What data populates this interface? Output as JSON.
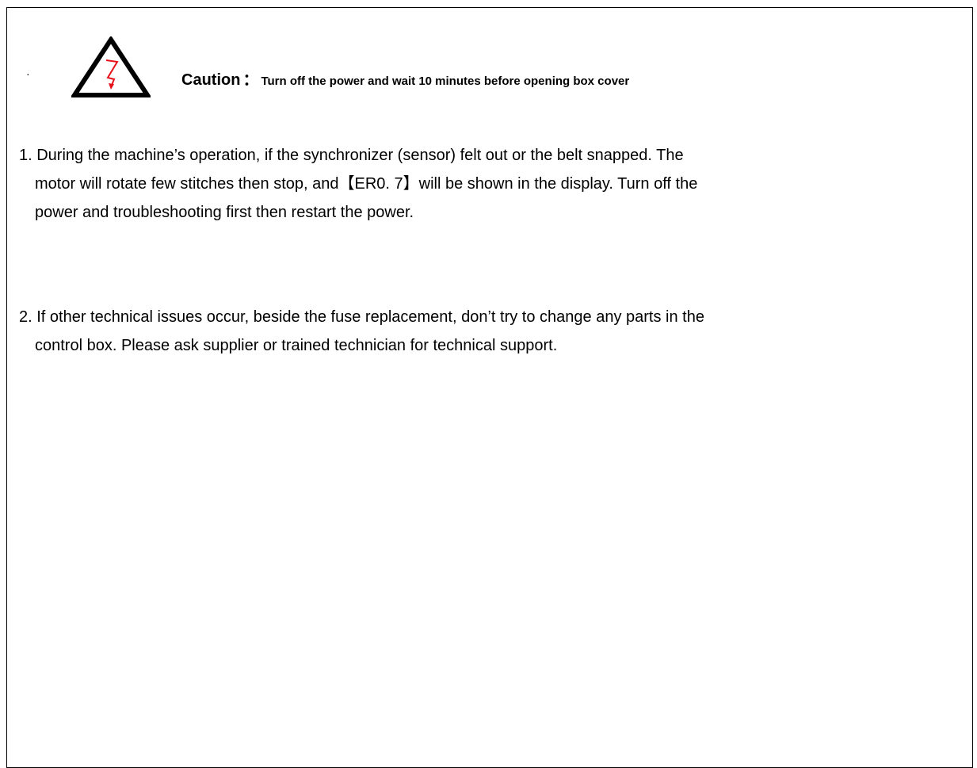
{
  "caution": {
    "bullet": "·",
    "label": "Caution",
    "colon": "：",
    "text": "Turn off the power and wait 10 minutes before opening box cover",
    "icon": "high-voltage-warning-icon",
    "icon_color": "#e8121b"
  },
  "notes": [
    {
      "lines": [
        "1. During the machine’s operation, if the synchronizer (sensor) felt out or the belt snapped. The",
        "motor will rotate few stitches then stop, and【ER0. 7】will be shown in the display. Turn off the",
        "power and troubleshooting first then restart the power."
      ]
    },
    {
      "lines": [
        "2. If other technical issues occur, beside the fuse replacement, don’t try to change any parts in the",
        "control box. Please ask supplier or trained technician for technical support."
      ]
    }
  ]
}
